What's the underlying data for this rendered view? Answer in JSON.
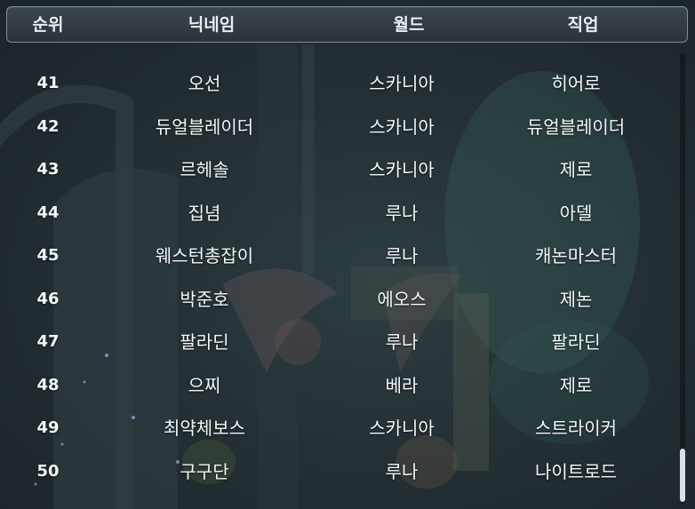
{
  "header": {
    "rank": "순위",
    "nickname": "닉네임",
    "world": "월드",
    "job": "직업"
  },
  "rows": [
    {
      "rank": "41",
      "nickname": "오선",
      "world": "스카니아",
      "job": "히어로"
    },
    {
      "rank": "42",
      "nickname": "듀얼블레이더",
      "world": "스카니아",
      "job": "듀얼블레이더"
    },
    {
      "rank": "43",
      "nickname": "르헤솔",
      "world": "스카니아",
      "job": "제로"
    },
    {
      "rank": "44",
      "nickname": "집념",
      "world": "루나",
      "job": "아델"
    },
    {
      "rank": "45",
      "nickname": "웨스턴총잡이",
      "world": "루나",
      "job": "캐논마스터"
    },
    {
      "rank": "46",
      "nickname": "박준호",
      "world": "에오스",
      "job": "제논"
    },
    {
      "rank": "47",
      "nickname": "팔라딘",
      "world": "루나",
      "job": "팔라딘"
    },
    {
      "rank": "48",
      "nickname": "으찌",
      "world": "베라",
      "job": "제로"
    },
    {
      "rank": "49",
      "nickname": "최약체보스",
      "world": "스카니아",
      "job": "스트라이커"
    },
    {
      "rank": "50",
      "nickname": "구구단",
      "world": "루나",
      "job": "나이트로드"
    }
  ],
  "colors": {
    "header_border": "#7d8c93",
    "background": "#243034",
    "text": "#f4f6f7",
    "scroll_thumb": "#d9dfe2"
  }
}
